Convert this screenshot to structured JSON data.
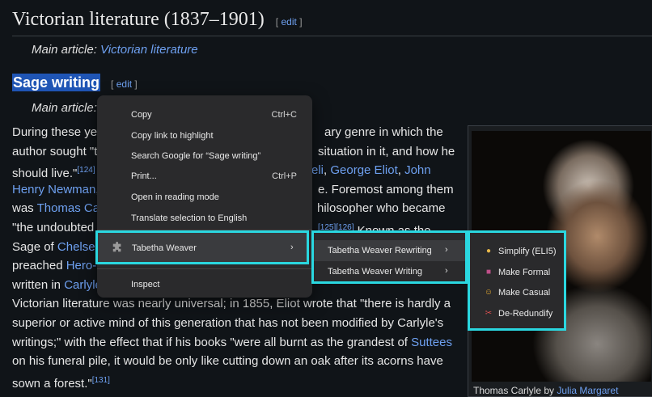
{
  "heading": {
    "title": "Victorian literature (1837–1901)",
    "edit_open": "[",
    "edit_label": "edit",
    "edit_close": "]"
  },
  "hatnote1": {
    "prefix": "Main article: ",
    "link": "Victorian literature"
  },
  "subheading": {
    "title": "Sage writing",
    "edit_open": "[",
    "edit_label": "edit",
    "edit_close": "]"
  },
  "hatnote2": {
    "prefix": "Main article:"
  },
  "paragraph": {
    "l1": "During these ye",
    "l1b": "ary genre in which the",
    "l2": "author sought \"t",
    "l2b": "situation in it, and how he",
    "l3": "should live.\"",
    "l3_ref": "[124]",
    "l3b_link1": "eli",
    "l3b_sep": ", ",
    "l3b_link2": "George Eliot",
    "l3b_sep2": ", ",
    "l3b_link3": "John",
    "l4_link": "Henry Newman",
    "l4a": ",",
    "l4b": "e. Foremost among them",
    "l5": "was ",
    "l5_link": "Thomas Ca",
    "l5b": "hilosopher who became",
    "l6": "\"the undoubted",
    "l6_ref": "[125][126]",
    "l6b": " Known as the",
    "l7": "Sage of ",
    "l7_link": "Chelse",
    "l8": "preached ",
    "l8_link": "Hero-",
    "l9": "written in ",
    "l9_link": "Carlyle",
    "l10": "Victorian literature was nearly universal; in 1855, Eliot wrote that \"there is hardly a",
    "l11": "superior or active mind of this generation that has not been modified by Carlyle's",
    "l12": "writings;\" with the effect that if his books \"were all burnt as the grandest of ",
    "l12_link": "Suttees",
    "l13": "on his funeral pile, it would be only like cutting down an oak after its acorns have",
    "l14": "sown a forest.\"",
    "l14_ref": "[131]"
  },
  "image": {
    "caption_prefix": "Thomas Carlyle by ",
    "caption_link": "Julia Margaret"
  },
  "context_menu": {
    "items": [
      {
        "label": "Copy",
        "shortcut": "Ctrl+C"
      },
      {
        "label": "Copy link to highlight",
        "shortcut": ""
      },
      {
        "label": "Search Google for “Sage writing”",
        "shortcut": ""
      },
      {
        "label": "Print...",
        "shortcut": "Ctrl+P"
      },
      {
        "label": "Open in reading mode",
        "shortcut": ""
      },
      {
        "label": "Translate selection to English",
        "shortcut": ""
      }
    ],
    "extension_label": "Tabetha Weaver",
    "inspect_label": "Inspect"
  },
  "submenu": {
    "rewriting_label": "Tabetha Weaver Rewriting",
    "writing_label": "Tabetha Weaver Writing",
    "arrow": "›"
  },
  "rewrite_menu": {
    "items": [
      {
        "icon": "🧒",
        "label": "Simplify (ELI5)"
      },
      {
        "icon": "💼",
        "label": "Make Formal"
      },
      {
        "icon": "😊",
        "label": "Make Casual"
      },
      {
        "icon": "✂",
        "label": "De-Redundify"
      }
    ]
  },
  "colors": {
    "highlight_border": "#2ad7e0",
    "link": "#6ea0f0",
    "selection": "#1f55b5"
  }
}
